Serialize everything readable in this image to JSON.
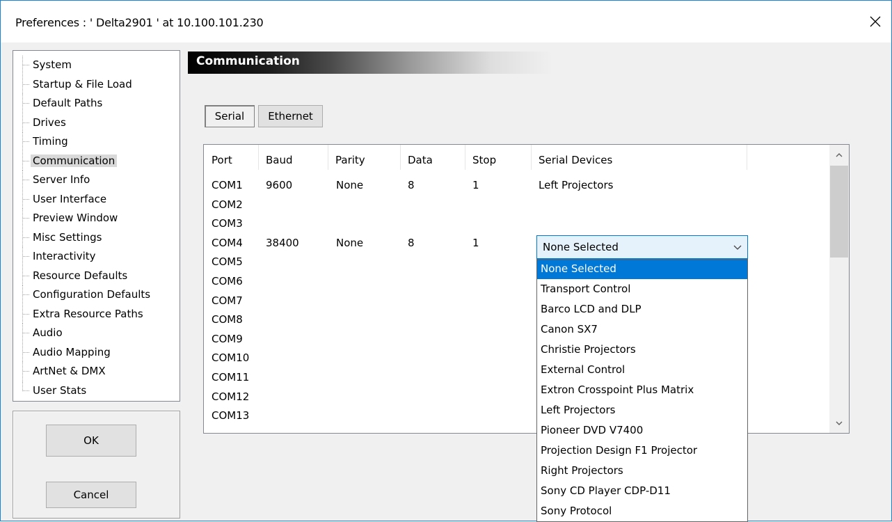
{
  "window": {
    "title": "Preferences  :  ' Delta2901 '  at  10.100.101.230",
    "accent": "#0078d7"
  },
  "tree": {
    "items": [
      {
        "label": "System"
      },
      {
        "label": "Startup & File Load"
      },
      {
        "label": "Default Paths"
      },
      {
        "label": "Drives"
      },
      {
        "label": "Timing"
      },
      {
        "label": "Communication",
        "selected": true
      },
      {
        "label": "Server Info"
      },
      {
        "label": "User Interface"
      },
      {
        "label": "Preview Window"
      },
      {
        "label": "Misc Settings"
      },
      {
        "label": "Interactivity"
      },
      {
        "label": "Resource Defaults"
      },
      {
        "label": "Configuration Defaults"
      },
      {
        "label": "Extra Resource Paths"
      },
      {
        "label": "Audio"
      },
      {
        "label": "Audio Mapping"
      },
      {
        "label": "ArtNet & DMX"
      },
      {
        "label": "User Stats"
      }
    ]
  },
  "buttons": {
    "ok": "OK",
    "cancel": "Cancel"
  },
  "section": {
    "title": "Communication"
  },
  "tabs": [
    {
      "label": "Serial",
      "active": true
    },
    {
      "label": "Ethernet",
      "active": false
    }
  ],
  "table": {
    "columns": [
      "Port",
      "Baud",
      "Parity",
      "Data",
      "Stop",
      "Serial Devices"
    ],
    "rows": [
      {
        "port": "COM1",
        "baud": "9600",
        "parity": "None",
        "data": "8",
        "stop": "1",
        "device": "Left Projectors"
      },
      {
        "port": "COM2",
        "baud": "",
        "parity": "",
        "data": "",
        "stop": "",
        "device": ""
      },
      {
        "port": "COM3",
        "baud": "",
        "parity": "",
        "data": "",
        "stop": "",
        "device": ""
      },
      {
        "port": "COM4",
        "baud": "38400",
        "parity": "None",
        "data": "8",
        "stop": "1",
        "device": ""
      },
      {
        "port": "COM5",
        "baud": "",
        "parity": "",
        "data": "",
        "stop": "",
        "device": ""
      },
      {
        "port": "COM6",
        "baud": "",
        "parity": "",
        "data": "",
        "stop": "",
        "device": ""
      },
      {
        "port": "COM7",
        "baud": "",
        "parity": "",
        "data": "",
        "stop": "",
        "device": ""
      },
      {
        "port": "COM8",
        "baud": "",
        "parity": "",
        "data": "",
        "stop": "",
        "device": ""
      },
      {
        "port": "COM9",
        "baud": "",
        "parity": "",
        "data": "",
        "stop": "",
        "device": ""
      },
      {
        "port": "COM10",
        "baud": "",
        "parity": "",
        "data": "",
        "stop": "",
        "device": ""
      },
      {
        "port": "COM11",
        "baud": "",
        "parity": "",
        "data": "",
        "stop": "",
        "device": ""
      },
      {
        "port": "COM12",
        "baud": "",
        "parity": "",
        "data": "",
        "stop": "",
        "device": ""
      },
      {
        "port": "COM13",
        "baud": "",
        "parity": "",
        "data": "",
        "stop": "",
        "device": ""
      }
    ]
  },
  "combo": {
    "value": "None Selected",
    "options": [
      "None Selected",
      "Transport Control",
      "Barco LCD and DLP",
      "Canon SX7",
      "Christie Projectors",
      "External Control",
      "Extron Crosspoint Plus Matrix",
      "Left Projectors",
      "Pioneer DVD V7400",
      "Projection Design F1 Projector",
      "Right Projectors",
      "Sony CD Player CDP-D11",
      "Sony Protocol"
    ],
    "highlighted_index": 0
  },
  "icons": {
    "close": "close-icon",
    "scroll_up": "chevron-up-icon",
    "scroll_down": "chevron-down-icon",
    "combo_arrow": "chevron-down-icon"
  }
}
